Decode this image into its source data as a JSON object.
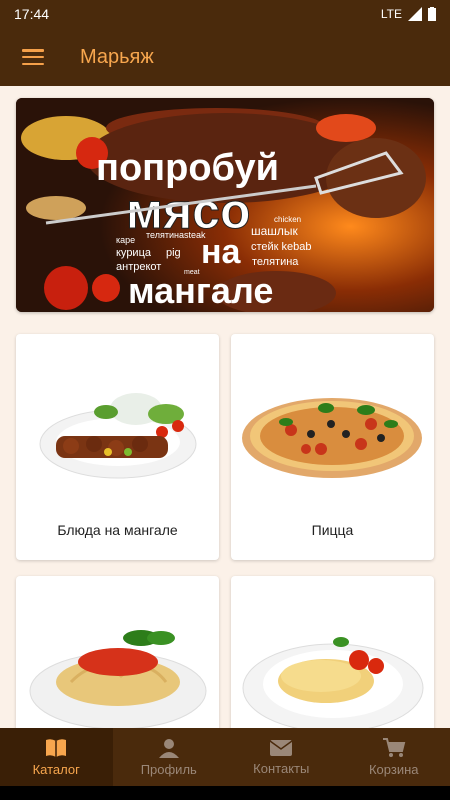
{
  "status": {
    "time": "17:44",
    "network": "LTE"
  },
  "appbar": {
    "title": "Марьяж"
  },
  "banner": {
    "line1": "попробуй",
    "line2": "мясо",
    "line3": "на",
    "line4": "мангале",
    "tags": [
      "каре",
      "телятина",
      "курица",
      "pig",
      "антрекот",
      "steak",
      "шашлык",
      "стейк kebab",
      "телятина",
      "chicken",
      "meat"
    ]
  },
  "categories": [
    {
      "label": "Блюда на мангале",
      "image": "shashlik-plate"
    },
    {
      "label": "Пицца",
      "image": "pizza"
    },
    {
      "label": "",
      "image": "spaghetti-plate"
    },
    {
      "label": "",
      "image": "omelette-plate"
    }
  ],
  "nav": [
    {
      "label": "Каталог",
      "icon": "book-icon"
    },
    {
      "label": "Профиль",
      "icon": "person-icon"
    },
    {
      "label": "Контакты",
      "icon": "mail-icon"
    },
    {
      "label": "Корзина",
      "icon": "cart-icon"
    }
  ],
  "colors": {
    "primary": "#4a2a0c",
    "accent": "#f7a64e",
    "background": "#fbf1e8"
  }
}
